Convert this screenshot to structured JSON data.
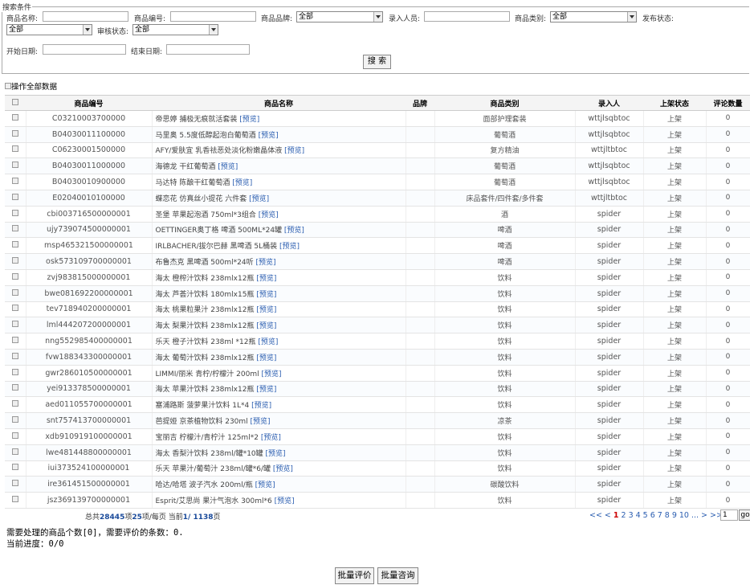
{
  "search": {
    "legend": "搜索条件",
    "labels": {
      "name": "商品名称:",
      "code": "商品编号:",
      "brand": "商品品牌:",
      "entry_user": "录入人员:",
      "category": "商品类别:",
      "publish_status": "发布状态:",
      "review_status": "审核状态:",
      "start_date": "开始日期:",
      "end_date": "结束日期:"
    },
    "brand_value": "全部",
    "category_value": "全部",
    "publish_value": "全部",
    "review_value": "全部",
    "search_button": "搜 索"
  },
  "operate_all": "操作全部数据",
  "table": {
    "headers": [
      "商品编号",
      "商品名称",
      "品牌",
      "商品类别",
      "录入人",
      "上架状态",
      "评论数量"
    ],
    "preview_label": "[预览]",
    "rows": [
      {
        "code": "C03210003700000",
        "name": "帝思婷 捕极无痕就活套装",
        "brand": "",
        "category": "面部护理套装",
        "user": "wttjlsqbtoc",
        "status": "上架",
        "comments": "0"
      },
      {
        "code": "B04030011100000",
        "name": "马里奥 5.5度低醇起泡白葡萄酒",
        "brand": "",
        "category": "葡萄酒",
        "user": "wttjlsqbtoc",
        "status": "上架",
        "comments": "0"
      },
      {
        "code": "C06230001500000",
        "name": "AFY/爱肤宜 乳香祛恶处淡化粉嫩晶体液",
        "brand": "",
        "category": "复方精油",
        "user": "wttjltbtoc",
        "status": "上架",
        "comments": "0"
      },
      {
        "code": "B04030011000000",
        "name": "海德龙 干红葡萄酒",
        "brand": "",
        "category": "葡萄酒",
        "user": "wttjlsqbtoc",
        "status": "上架",
        "comments": "0"
      },
      {
        "code": "B04030010900000",
        "name": "马达特 陈酿干红葡萄酒",
        "brand": "",
        "category": "葡萄酒",
        "user": "wttjlsqbtoc",
        "status": "上架",
        "comments": "0"
      },
      {
        "code": "E02040010100000",
        "name": "蝶恋花 仿真丝小提花 六件套",
        "brand": "",
        "category": "床品套件/四件套/多件套",
        "user": "wttjltbtoc",
        "status": "上架",
        "comments": "0"
      },
      {
        "code": "cbi003716500000001",
        "name": "圣堡 苹果起泡酒 750ml*3组合",
        "brand": "",
        "category": "酒",
        "user": "spider",
        "status": "上架",
        "comments": "0"
      },
      {
        "code": "ujy739074500000001",
        "name": "OETTINGER奥丁格 啤酒 500ML*24罐",
        "brand": "",
        "category": "啤酒",
        "user": "spider",
        "status": "上架",
        "comments": "0"
      },
      {
        "code": "msp465321500000001",
        "name": "IRLBACHER/拔尔巴赫 黑啤酒 5L桶装",
        "brand": "",
        "category": "啤酒",
        "user": "spider",
        "status": "上架",
        "comments": "0"
      },
      {
        "code": "osk573109700000001",
        "name": "布鲁杰克 黑啤酒 500ml*24听",
        "brand": "",
        "category": "啤酒",
        "user": "spider",
        "status": "上架",
        "comments": "0"
      },
      {
        "code": "zvj983815000000001",
        "name": "海太 橙榨汁饮料 238mlx12瓶",
        "brand": "",
        "category": "饮料",
        "user": "spider",
        "status": "上架",
        "comments": "0"
      },
      {
        "code": "bwe081692200000001",
        "name": "海太 芦荟汁饮料 180mlx15瓶",
        "brand": "",
        "category": "饮料",
        "user": "spider",
        "status": "上架",
        "comments": "0"
      },
      {
        "code": "tev718940200000001",
        "name": "海太 桃果粒果汁 238mlx12瓶",
        "brand": "",
        "category": "饮料",
        "user": "spider",
        "status": "上架",
        "comments": "0"
      },
      {
        "code": "lml444207200000001",
        "name": "海太 梨果汁饮料 238mlx12瓶",
        "brand": "",
        "category": "饮料",
        "user": "spider",
        "status": "上架",
        "comments": "0"
      },
      {
        "code": "nng552985400000001",
        "name": "乐天 橙子汁饮料 238ml *12瓶",
        "brand": "",
        "category": "饮料",
        "user": "spider",
        "status": "上架",
        "comments": "0"
      },
      {
        "code": "fvw188343300000001",
        "name": "海太 葡萄汁饮料 238mlx12瓶",
        "brand": "",
        "category": "饮料",
        "user": "spider",
        "status": "上架",
        "comments": "0"
      },
      {
        "code": "gwr286010500000001",
        "name": "LIMMI/丽米 青柠/柠檬汁 200ml",
        "brand": "",
        "category": "饮料",
        "user": "spider",
        "status": "上架",
        "comments": "0"
      },
      {
        "code": "yei913378500000001",
        "name": "海太 苹果汁饮料 238mlx12瓶",
        "brand": "",
        "category": "饮料",
        "user": "spider",
        "status": "上架",
        "comments": "0"
      },
      {
        "code": "aed011055700000001",
        "name": "塞浦路斯 菠萝果汁饮料 1L*4",
        "brand": "",
        "category": "饮料",
        "user": "spider",
        "status": "上架",
        "comments": "0"
      },
      {
        "code": "snt757413700000001",
        "name": "芭提娅 京茶植物饮料 230ml",
        "brand": "",
        "category": "凉茶",
        "user": "spider",
        "status": "上架",
        "comments": "0"
      },
      {
        "code": "xdb910919100000001",
        "name": "宝丽吉 柠檬汁/青柠汁 125ml*2",
        "brand": "",
        "category": "饮料",
        "user": "spider",
        "status": "上架",
        "comments": "0"
      },
      {
        "code": "lwe481448800000001",
        "name": "海太 香梨汁饮料 238ml/罐*10罐",
        "brand": "",
        "category": "饮料",
        "user": "spider",
        "status": "上架",
        "comments": "0"
      },
      {
        "code": "iui373524100000001",
        "name": "乐天 苹果汁/葡萄汁 238ml/罐*6/罐",
        "brand": "",
        "category": "饮料",
        "user": "spider",
        "status": "上架",
        "comments": "0"
      },
      {
        "code": "ire361451500000001",
        "name": "哈达/哈塔 波子汽水 200ml/瓶",
        "brand": "",
        "category": "碳酸饮料",
        "user": "spider",
        "status": "上架",
        "comments": "0"
      },
      {
        "code": "jsz369139700000001",
        "name": "Esprit/艾思尚 果汁气泡水 300ml*6",
        "brand": "",
        "category": "饮料",
        "user": "spider",
        "status": "上架",
        "comments": "0"
      }
    ]
  },
  "pager": {
    "total_prefix": "总共",
    "total": "28445",
    "total_suffix": "项",
    "per_page": "25",
    "per_page_suffix": "项/每页 当前",
    "current": "1/ 1138",
    "current_suffix": "页",
    "links": [
      "<<",
      "<"
    ],
    "pages": [
      "1",
      "2",
      "3",
      "4",
      "5",
      "6",
      "7",
      "8",
      "9",
      "10"
    ],
    "after": [
      "...",
      ">",
      ">>"
    ],
    "go_value": "1",
    "go_label": "go"
  },
  "info": {
    "line1": "需要处理的商品个数[0]，需要评价的条数：0.",
    "line2": "当前进度：0/0"
  },
  "buttons": {
    "batch_review": "批量评价",
    "batch_consult": "批量咨询"
  }
}
